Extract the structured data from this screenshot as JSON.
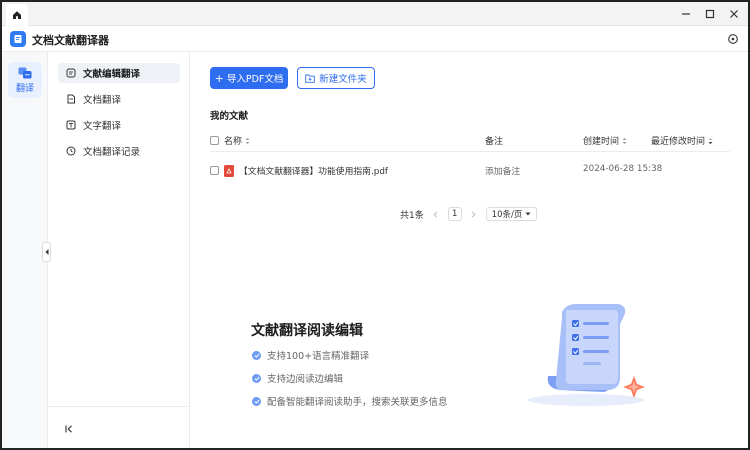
{
  "window": {
    "app_title": "文档文献翻译器",
    "tab_icon": "home-icon",
    "controls": [
      "minimize-icon",
      "maximize-icon",
      "close-icon"
    ]
  },
  "rail": {
    "items": [
      {
        "label": "翻译",
        "icon": "translate-icon",
        "active": true
      }
    ]
  },
  "sidebar": {
    "items": [
      {
        "label": "文献编辑翻译",
        "icon": "document-edit-icon",
        "active": true
      },
      {
        "label": "文档翻译",
        "icon": "document-icon",
        "active": false
      },
      {
        "label": "文字翻译",
        "icon": "text-icon",
        "active": false
      },
      {
        "label": "文档翻译记录",
        "icon": "clock-icon",
        "active": false
      }
    ],
    "collapse_icon": "collapse-left-icon"
  },
  "toolbar": {
    "import_label": "导入PDF文档",
    "new_folder_label": "新建文件夹"
  },
  "files": {
    "section_title": "我的文献",
    "columns": {
      "name": "名称",
      "note": "备注",
      "created": "创建时间",
      "modified": "最近修改时间"
    },
    "rows": [
      {
        "name": "【文档文献翻译器】功能使用指南.pdf",
        "note": "添加备注",
        "created": "2024-06-28 15:38",
        "modified": ""
      }
    ]
  },
  "pagination": {
    "total": "共1条",
    "current_page": "1",
    "page_size": "10条/页"
  },
  "promo": {
    "title": "文献翻译阅读编辑",
    "features": [
      "支持100+语言精准翻译",
      "支持边阅读边编辑",
      "配备智能翻译阅读助手，搜索关联更多信息"
    ]
  },
  "colors": {
    "accent": "#2f6df0",
    "pdf_icon": "#e24a3b",
    "active_nav_bg": "#eef1f6"
  }
}
